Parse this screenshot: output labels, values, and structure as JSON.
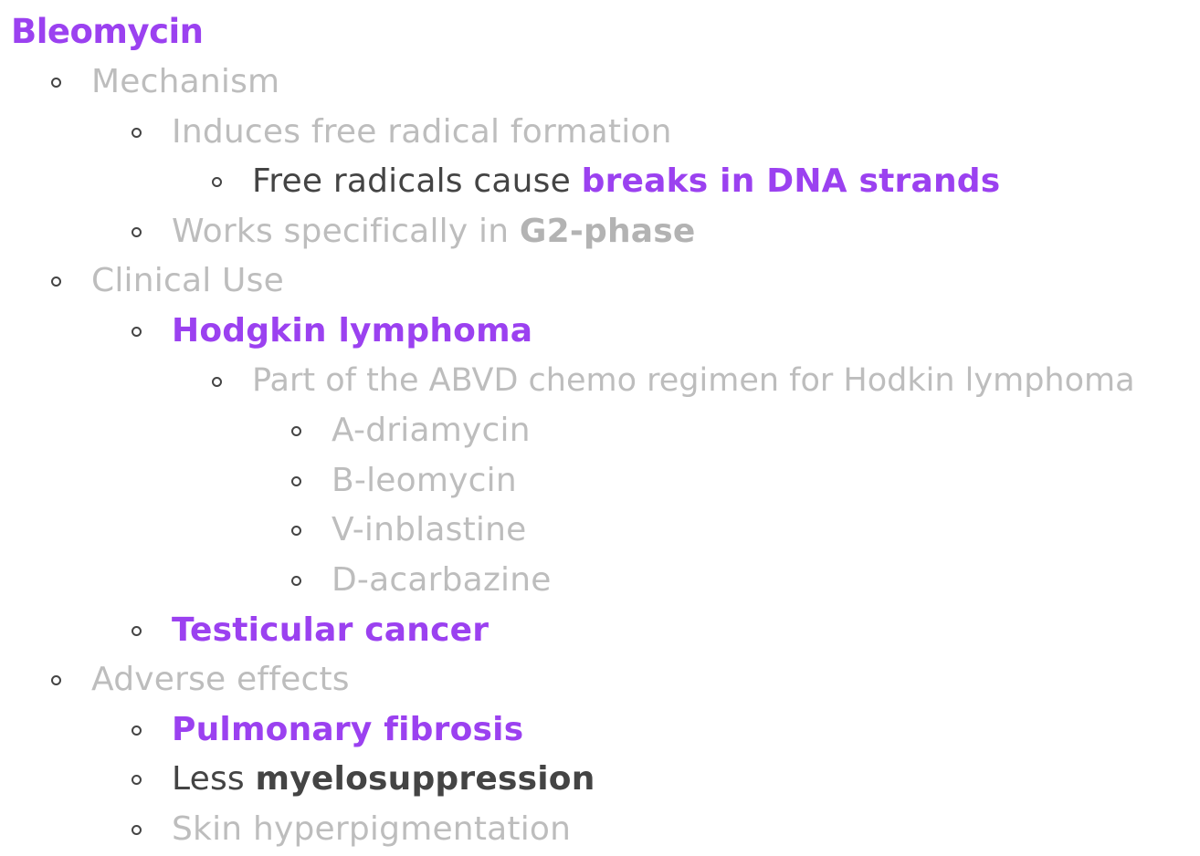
{
  "title": "Bleomycin",
  "items": [
    {
      "id": "mechanism",
      "text": "Mechanism"
    },
    {
      "id": "induces",
      "text": "Induces free radical formation"
    },
    {
      "id": "free-radicals",
      "text": "Free radicals cause ",
      "emph": "breaks in DNA strands"
    },
    {
      "id": "works",
      "text": "Works specifically in ",
      "emph": "G2-phase"
    },
    {
      "id": "clinical-use",
      "text": "Clinical Use"
    },
    {
      "id": "hodgkin",
      "emph": "Hodgkin lymphoma"
    },
    {
      "id": "abvd",
      "text": "Part of the ABVD chemo regimen for Hodkin lymphoma"
    },
    {
      "id": "a",
      "text": "A-driamycin"
    },
    {
      "id": "b",
      "text": "B-leomycin"
    },
    {
      "id": "v",
      "text": "V-inblastine"
    },
    {
      "id": "d",
      "text": "D-acarbazine"
    },
    {
      "id": "testicular",
      "emph": "Testicular cancer"
    },
    {
      "id": "adverse",
      "text": "Adverse effects"
    },
    {
      "id": "pulmonary",
      "emph": "Pulmonary fibrosis"
    },
    {
      "id": "less",
      "text": "Less ",
      "emph": "myelosuppression"
    },
    {
      "id": "skin",
      "text": "Skin hyperpigmentation"
    }
  ],
  "colors": {
    "accent": "#9b41f0",
    "muted": "#bdbdbd",
    "dark": "#444444"
  }
}
